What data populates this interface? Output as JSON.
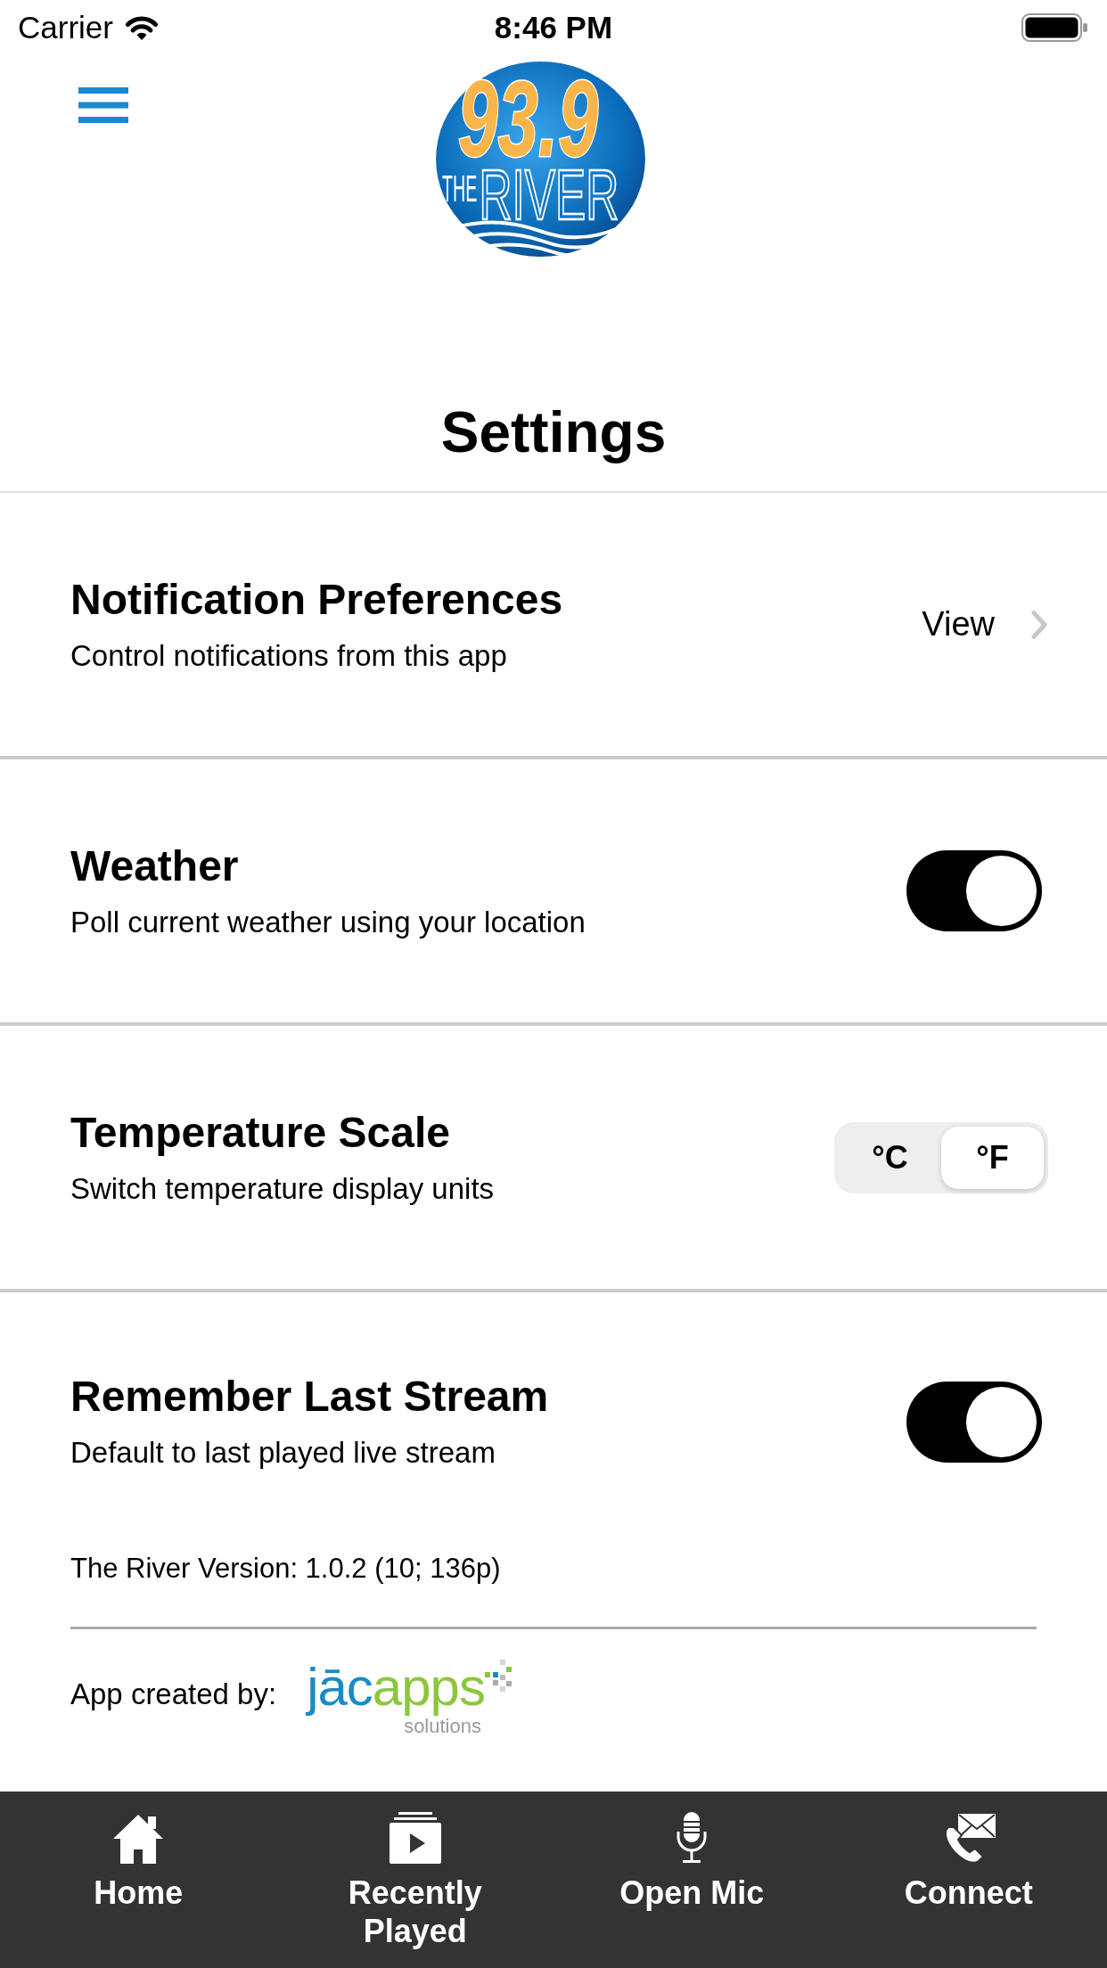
{
  "status_bar": {
    "carrier": "Carrier",
    "time": "8:46 PM"
  },
  "header": {
    "logo": {
      "number": "93.9",
      "prefix": "THE",
      "name": "RIVER"
    }
  },
  "title": "Settings",
  "rows": [
    {
      "kind": "link",
      "title": "Notification Preferences",
      "subtitle": "Control notifications from this app",
      "action": "View"
    },
    {
      "kind": "toggle",
      "title": "Weather",
      "subtitle": "Poll current weather using your location",
      "on": true
    },
    {
      "kind": "segmented",
      "title": "Temperature Scale",
      "subtitle": "Switch temperature display units",
      "options": [
        {
          "label": "°C",
          "selected": false
        },
        {
          "label": "°F",
          "selected": true
        }
      ]
    },
    {
      "kind": "toggle",
      "title": "Remember Last Stream",
      "subtitle": "Default to last played live stream",
      "on": true
    }
  ],
  "version": "The River Version: 1.0.2 (10; 136p)",
  "credit": {
    "label": "App created by:",
    "brand_part_1": "jāc",
    "brand_part_2": "apps",
    "tagline": "solutions"
  },
  "tab_bar": {
    "items": [
      {
        "label": "Home"
      },
      {
        "label": "Recently Played"
      },
      {
        "label": "Open Mic"
      },
      {
        "label": "Connect"
      }
    ]
  }
}
